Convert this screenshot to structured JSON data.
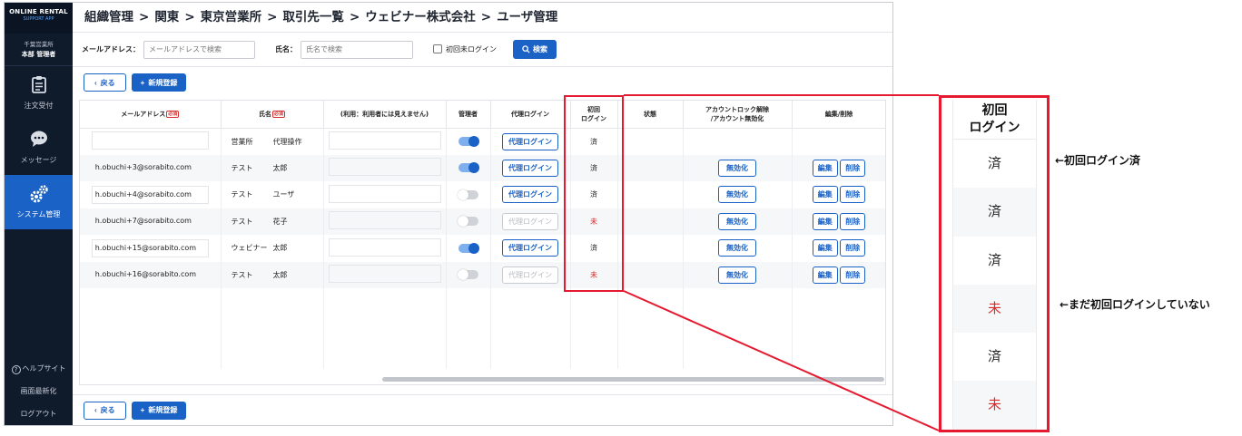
{
  "sidebar": {
    "logo_line1": "ONLINE RENTAL",
    "logo_line2": "SUPPORT APP",
    "user_org": "千葉営業所",
    "user_name": "本部 管理者",
    "nav": [
      {
        "label": "注文受付",
        "icon": "clipboard-icon"
      },
      {
        "label": "メッセージ",
        "icon": "chat-bubble-icon"
      },
      {
        "label": "システム管理",
        "icon": "gears-icon"
      }
    ],
    "bottom": [
      "ヘルプサイト",
      "画面最新化",
      "ログアウト"
    ]
  },
  "breadcrumb": [
    "組織管理",
    "関東",
    "東京営業所",
    "取引先一覧",
    "ウェビナー株式会社",
    "ユーザ管理"
  ],
  "search": {
    "email_label": "メールアドレス：",
    "email_placeholder": "メールアドレスで検索",
    "name_label": "氏名：",
    "name_placeholder": "氏名で検索",
    "first_login_label": "初回未ログイン",
    "search_button": "検索"
  },
  "actions": {
    "back": "戻る",
    "new": "新規登録"
  },
  "table": {
    "headers": {
      "email": "メールアドレス",
      "required": "必須",
      "name": "氏名",
      "memo": "(利用：利用者には見えません)",
      "admin": "管理者",
      "proxy": "代理ログイン",
      "first_login_1": "初回",
      "first_login_2": "ログイン",
      "status": "状態",
      "lock_1": "アカウントロック解除",
      "lock_2": "/アカウント無効化",
      "edit": "編集/削除"
    },
    "rows": [
      {
        "email": "",
        "last": "営業所",
        "first": "代理操作",
        "admin": true,
        "proxy_enabled": true,
        "first_login": "済",
        "has_actions": false
      },
      {
        "email": "h.obuchi+3@sorabito.com",
        "last": "テスト",
        "first": "太郎",
        "admin": true,
        "proxy_enabled": true,
        "first_login": "済",
        "has_actions": true
      },
      {
        "email": "h.obuchi+4@sorabito.com",
        "last": "テスト",
        "first": "ユーザ",
        "admin": false,
        "proxy_enabled": true,
        "first_login": "済",
        "has_actions": true
      },
      {
        "email": "h.obuchi+7@sorabito.com",
        "last": "テスト",
        "first": "花子",
        "admin": false,
        "proxy_enabled": false,
        "first_login": "未",
        "has_actions": true
      },
      {
        "email": "h.obuchi+15@sorabito.com",
        "last": "ウェビナー",
        "first": "太郎",
        "admin": true,
        "proxy_enabled": true,
        "first_login": "済",
        "has_actions": true
      },
      {
        "email": "h.obuchi+16@sorabito.com",
        "last": "テスト",
        "first": "太郎",
        "admin": false,
        "proxy_enabled": false,
        "first_login": "未",
        "has_actions": true
      }
    ],
    "proxy_button": "代理ログイン",
    "disable_button": "無効化",
    "edit_button": "編集",
    "delete_button": "削除"
  },
  "zoom": {
    "header_1": "初回",
    "header_2": "ログイン",
    "values": [
      "済",
      "済",
      "済",
      "未",
      "済",
      "未"
    ]
  },
  "notes": {
    "done": "←初回ログイン済",
    "not_yet": "←まだ初回ログインしていない"
  },
  "colors": {
    "accent": "#1b62c6",
    "sidebar": "#0f1a2b",
    "callout": "#e5192f",
    "not_logged": "#d92b2b"
  }
}
